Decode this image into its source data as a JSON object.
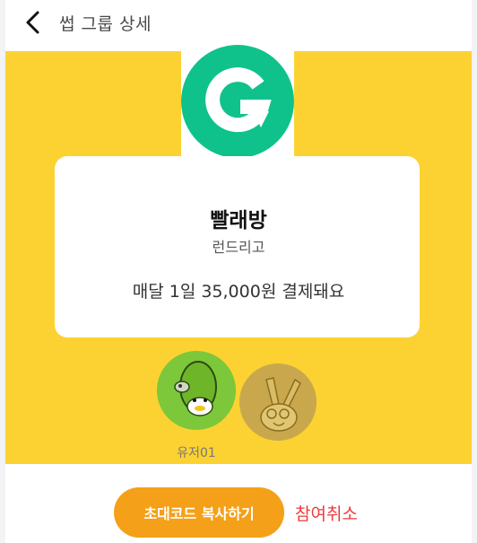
{
  "header": {
    "title": "썹 그룹 상세",
    "back_icon": "chevron-left-icon"
  },
  "group": {
    "logo_icon": "g-logo-icon",
    "logo_color": "#0fc28c",
    "name": "빨래방",
    "brand": "런드리고",
    "payment_text": "매달 1일 35,000원 결제돼요"
  },
  "members": [
    {
      "label": "유저01",
      "avatar": "crocodile-character-avatar",
      "active": true
    },
    {
      "label": "",
      "avatar": "rabbit-character-avatar",
      "active": false
    }
  ],
  "actions": {
    "invite_label": "초대코드 복사하기",
    "cancel_label": "참여취소"
  },
  "colors": {
    "hero_bg": "#fcd232",
    "button_bg": "#f4a019",
    "cancel_text": "#ee3b3b"
  }
}
